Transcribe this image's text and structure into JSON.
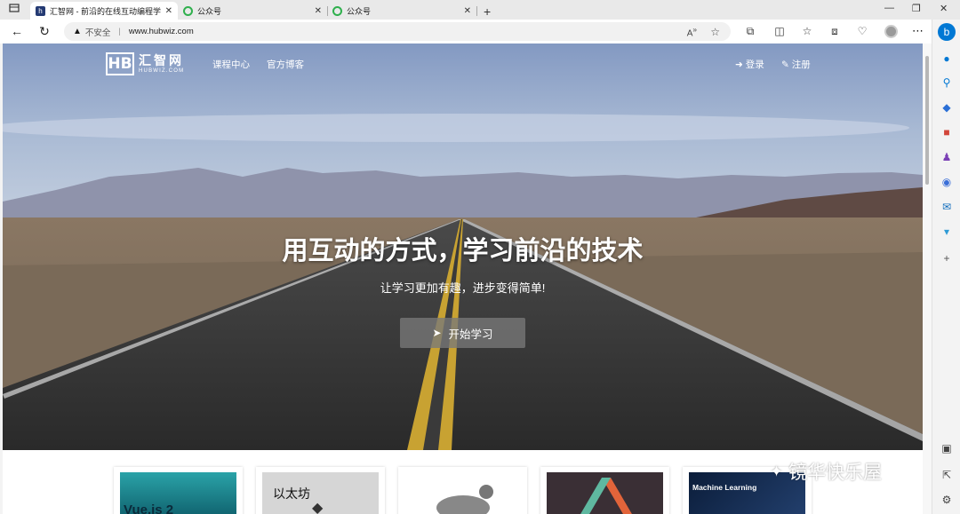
{
  "browser": {
    "tabs": [
      {
        "title": "汇智网 - 前沿的在线互动编程学",
        "favicon": "h",
        "active": true
      },
      {
        "title": "公众号",
        "favicon": "wechat-logo",
        "active": false
      },
      {
        "title": "公众号",
        "favicon": "wechat-logo",
        "active": false
      }
    ],
    "new_tab": "+",
    "security_label": "不安全",
    "url": "www.hubwiz.com",
    "window_controls": [
      "—",
      "❐",
      "✕"
    ]
  },
  "site": {
    "logo_mark": "HB",
    "logo_cn": "汇智网",
    "logo_en": "HUBWIZ.COM",
    "nav": [
      "课程中心",
      "官方博客"
    ],
    "login": "登录",
    "register": "注册"
  },
  "hero": {
    "title": "用互动的方式，学习前沿的技术",
    "subtitle": "让学习更加有趣，进步变得简单!",
    "cta": "开始学习"
  },
  "cards": [
    {
      "caption": "Vue.js 2"
    },
    {
      "caption": "以太坊"
    },
    {
      "caption": ""
    },
    {
      "caption": ""
    },
    {
      "caption": "Machine Learning"
    }
  ],
  "watermark": "镜华快乐屋",
  "colors": {
    "accent": "#0078d4",
    "cta_bg": "#7a7a7a",
    "sky": "#8fa6c6"
  }
}
